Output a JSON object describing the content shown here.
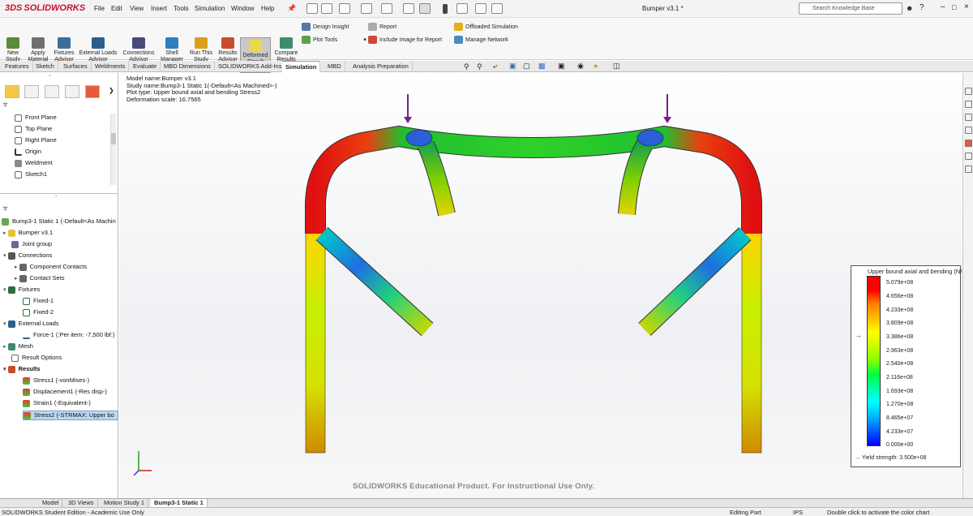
{
  "title_bar": {
    "app_logo": "SOLIDWORKS",
    "menu": [
      "File",
      "Edit",
      "View",
      "Insert",
      "Tools",
      "Simulation",
      "Window",
      "Help"
    ],
    "document_title": "Bumper v3.1 *",
    "search_placeholder": "Search Knowledge Base"
  },
  "ribbon": {
    "large_buttons": [
      {
        "label": "New Study",
        "icon": "new-study-icon"
      },
      {
        "label": "Apply Material",
        "icon": "apply-material-icon"
      },
      {
        "label": "Fixtures Advisor",
        "icon": "fixtures-icon"
      },
      {
        "label": "External Loads Advisor",
        "icon": "external-loads-icon"
      },
      {
        "label": "Connections Advisor",
        "icon": "connections-icon"
      },
      {
        "label": "Shell Manager",
        "icon": "shell-icon"
      },
      {
        "label": "Run This Study",
        "icon": "run-icon"
      },
      {
        "label": "Results Advisor",
        "icon": "results-icon"
      },
      {
        "label": "Deformed Result",
        "icon": "deformed-icon"
      },
      {
        "label": "Compare Results",
        "icon": "compare-icon"
      }
    ],
    "small_buttons": [
      {
        "label": "Design Insight"
      },
      {
        "label": "Plot Tools"
      },
      {
        "label": "Report"
      },
      {
        "label": "Include Image for Report"
      },
      {
        "label": "Offloaded Simulation"
      },
      {
        "label": "Manage Network"
      }
    ]
  },
  "command_tabs": [
    "Features",
    "Sketch",
    "Surfaces",
    "Weldments",
    "Evaluate",
    "MBD Dimensions",
    "SOLIDWORKS Add-Ins",
    "Simulation",
    "MBD",
    "Analysis Preparation"
  ],
  "active_command_tab": "Simulation",
  "feature_tree": [
    {
      "label": "Front Plane"
    },
    {
      "label": "Top Plane"
    },
    {
      "label": "Right Plane"
    },
    {
      "label": "Origin"
    },
    {
      "label": "Weldment"
    },
    {
      "label": "Sketch1"
    }
  ],
  "sim_tree": [
    {
      "label": "Bump3-1 Static 1 (-Default<As Machin"
    },
    {
      "label": "Bumper v3.1"
    },
    {
      "label": "Joint group"
    },
    {
      "label": "Connections"
    },
    {
      "label": "Component Contacts"
    },
    {
      "label": "Contact Sets"
    },
    {
      "label": "Fixtures"
    },
    {
      "label": "Fixed-1"
    },
    {
      "label": "Fixed-2"
    },
    {
      "label": "External Loads"
    },
    {
      "label": "Force-1 (:Per item: -7,500 lbf:)"
    },
    {
      "label": "Mesh"
    },
    {
      "label": "Result Options"
    },
    {
      "label": "Results"
    },
    {
      "label": "Stress1 (-vonMises-)"
    },
    {
      "label": "Displacement1 (-Res disp-)"
    },
    {
      "label": "Strain1 (-Equivalent-)"
    },
    {
      "label": "Stress2 (-STRMAX: Upper bo"
    }
  ],
  "plot_info": [
    "Model name:Bumper v3.1",
    "Study name:Bump3-1 Static 1(-Default<As Machined>-)",
    "Plot type: Upper bound axial and bending Stress2",
    "Deformation scale: 16.7565"
  ],
  "legend": {
    "title": "Upper bound axial and bending (N/m^2)",
    "values": [
      "5.079e+08",
      "4.656e+08",
      "4.233e+08",
      "3.809e+08",
      "3.386e+08",
      "2.963e+08",
      "2.540e+08",
      "2.116e+08",
      "1.693e+08",
      "1.270e+08",
      "8.465e+07",
      "4.233e+07",
      "0.000e+00"
    ],
    "yield_strength": "Yield strength: 3.500e+08"
  },
  "watermark": "SOLIDWORKS Educational Product. For Instructional Use Only.",
  "bottom_tabs": [
    "Model",
    "3D Views",
    "Motion Study 1",
    "Bump3-1 Static 1"
  ],
  "active_bottom_tab": "Bump3-1 Static 1",
  "status": {
    "left": "SOLIDWORKS Student Edition - Academic Use Only",
    "mode": "Editing Part",
    "units": "IPS",
    "hint": "Double click to activate the color chart"
  },
  "colors": {
    "accent_red": "#c8102e",
    "load_arrow": "#7a1b8c",
    "selection": "#bcd8f0"
  }
}
